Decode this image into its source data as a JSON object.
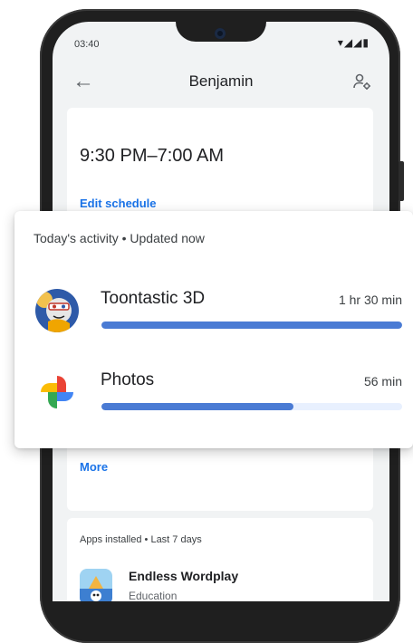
{
  "status_bar": {
    "time": "03:40",
    "icons": "▾◢◢▮"
  },
  "app_bar": {
    "title": "Benjamin"
  },
  "schedule": {
    "time_range": "9:30 PM–7:00 AM",
    "edit_label": "Edit schedule"
  },
  "activity": {
    "header": "Today's activity • Updated now",
    "apps": [
      {
        "name": "Toontastic 3D",
        "time": "1 hr 30 min",
        "usage_fraction": 1.0,
        "icon": "toontastic-app-icon"
      },
      {
        "name": "Photos",
        "time": "56 min",
        "usage_fraction": 0.64,
        "icon": "photos-app-icon"
      }
    ]
  },
  "more": {
    "label": "More"
  },
  "installed": {
    "header": "Apps installed • Last 7 days",
    "apps": [
      {
        "name": "Endless Wordplay",
        "category": "Education",
        "icon": "endless-wordplay-app-icon"
      }
    ]
  },
  "colors": {
    "accent": "#1a73e8",
    "bar_fill": "#4a7bd4",
    "bar_track": "#e8f0fe"
  }
}
